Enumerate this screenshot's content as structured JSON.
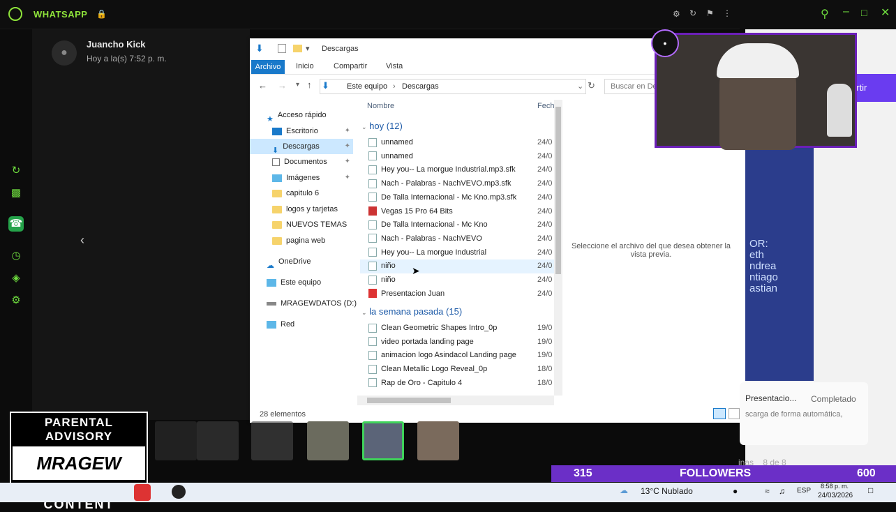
{
  "whatsapp": {
    "title": "WHATSAPP",
    "contact_name": "Juancho Kick",
    "contact_status": "Hoy a la(s) 7:52 p. m."
  },
  "explorer": {
    "title": "Descargas",
    "ribbon_tabs": [
      "Archivo",
      "Inicio",
      "Compartir",
      "Vista"
    ],
    "address": [
      "Este equipo",
      "Descargas"
    ],
    "search_placeholder": "Buscar en Descargas",
    "columns": {
      "name": "Nombre",
      "date": "Fech"
    },
    "nav": [
      {
        "label": "Acceso rápido",
        "type": "star"
      },
      {
        "label": "Escritorio",
        "type": "folder-blue",
        "pinned": true
      },
      {
        "label": "Descargas",
        "type": "download",
        "pinned": true,
        "selected": true
      },
      {
        "label": "Documentos",
        "type": "doc",
        "pinned": true
      },
      {
        "label": "Imágenes",
        "type": "image",
        "pinned": true
      },
      {
        "label": "capitulo 6",
        "type": "folder"
      },
      {
        "label": "logos y tarjetas",
        "type": "folder"
      },
      {
        "label": "NUEVOS TEMAS",
        "type": "folder"
      },
      {
        "label": "pagina web",
        "type": "folder"
      },
      {
        "label": "OneDrive",
        "type": "cloud"
      },
      {
        "label": "Este equipo",
        "type": "pc"
      },
      {
        "label": "MRAGEWDATOS (D:)",
        "type": "drive"
      },
      {
        "label": "Red",
        "type": "network"
      }
    ],
    "groups": [
      {
        "label": "hoy (12)",
        "files": [
          {
            "name": "unnamed",
            "date": "24/0"
          },
          {
            "name": "unnamed",
            "date": "24/0"
          },
          {
            "name": "Hey you-- La morgue Industrial.mp3.sfk",
            "date": "24/0"
          },
          {
            "name": "Nach - Palabras - NachVEVO.mp3.sfk",
            "date": "24/0"
          },
          {
            "name": "De Talla Internacional - Mc Kno.mp3.sfk",
            "date": "24/0"
          },
          {
            "name": "Vegas 15 Pro 64 Bits",
            "date": "24/0"
          },
          {
            "name": "De Talla Internacional - Mc Kno",
            "date": "24/0"
          },
          {
            "name": "Nach - Palabras - NachVEVO",
            "date": "24/0"
          },
          {
            "name": "Hey you-- La morgue Industrial",
            "date": "24/0"
          },
          {
            "name": "niño",
            "date": "24/0"
          },
          {
            "name": "niño",
            "date": "24/0"
          },
          {
            "name": "Presentacion Juan",
            "date": "24/0"
          }
        ]
      },
      {
        "label": "la semana pasada (15)",
        "files": [
          {
            "name": "Clean Geometric Shapes Intro_0p",
            "date": "19/0"
          },
          {
            "name": "video portada landing page",
            "date": "19/0"
          },
          {
            "name": "animacion logo Asindacol Landing page",
            "date": "19/0"
          },
          {
            "name": "Clean Metallic Logo Reveal_0p",
            "date": "18/0"
          },
          {
            "name": "Rap de Oro - Capitulo 4",
            "date": "18/0"
          }
        ]
      }
    ],
    "preview_message": "Seleccione el archivo del que desea obtener la vista previa.",
    "status_count": "28 elementos"
  },
  "right": {
    "share_label": "artir",
    "poster_text": "OR:\neth\nndrea\nntiago\nastian",
    "download_title": "Presentacio...",
    "download_status": "Completado",
    "download_sub": "scarga de forma automática,"
  },
  "overlay": {
    "followers_count": "315",
    "followers_label": "FOLLOWERS",
    "followers_goal": "600",
    "pages_label": "inas",
    "pages": "8 de 8",
    "advisory_top": "PARENTAL ADVISORY",
    "advisory_logo": "MRAGEW",
    "advisory_bottom": "EXPLICT CONTENT"
  },
  "taskbar": {
    "weather": "13°C Nublado",
    "lang": "ESP",
    "time": "8:58 p. m.",
    "date": "24/03/2026"
  }
}
